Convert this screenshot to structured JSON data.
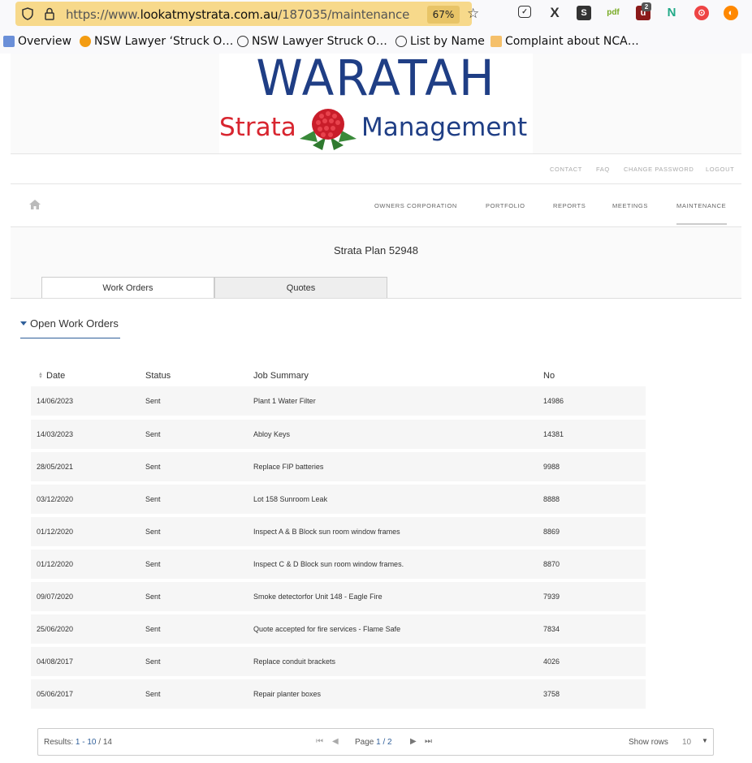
{
  "browser": {
    "url_prefix": "https://www.",
    "url_host": "lookatmystrata.com.au",
    "url_path": "/187035/maintenance",
    "zoom": "67%",
    "extensions": [
      "pocket-icon",
      "x-icon",
      "s-icon",
      "pdf-icon",
      "ublock-icon",
      "n-icon",
      "shield-icon",
      "firefox-icon"
    ],
    "extension_badge": "2",
    "bookmarks": [
      {
        "label": "Overview",
        "icon": "calendar-icon"
      },
      {
        "label": "NSW Lawyer ‘Struck O…",
        "icon": "news-icon"
      },
      {
        "label": "NSW Lawyer Struck O…",
        "icon": "globe-icon"
      },
      {
        "label": "List by Name",
        "icon": "globe-icon"
      },
      {
        "label": "Complaint about NCA…",
        "icon": "document-icon"
      }
    ]
  },
  "logo": {
    "title": "WARATAH",
    "word_left": "Strata",
    "word_right": "Management"
  },
  "utility_nav": [
    "CONTACT",
    "FAQ",
    "CHANGE PASSWORD",
    "LOGOUT"
  ],
  "main_nav": {
    "items": [
      "OWNERS CORPORATION",
      "PORTFOLIO",
      "REPORTS",
      "MEETINGS",
      "MAINTENANCE"
    ],
    "active": "MAINTENANCE"
  },
  "plan_title": "Strata Plan 52948",
  "tabs": [
    "Work Orders",
    "Quotes"
  ],
  "section_title": "Open Work Orders",
  "table": {
    "columns": [
      "Date",
      "Status",
      "Job Summary",
      "No"
    ],
    "rows": [
      {
        "date": "14/06/2023",
        "status": "Sent",
        "summary": "Plant 1 Water Filter",
        "no": "14986"
      },
      {
        "date": "14/03/2023",
        "status": "Sent",
        "summary": "Abloy Keys",
        "no": "14381"
      },
      {
        "date": "28/05/2021",
        "status": "Sent",
        "summary": "Replace FIP batteries",
        "no": "9988"
      },
      {
        "date": "03/12/2020",
        "status": "Sent",
        "summary": "Lot 158 Sunroom Leak",
        "no": "8888"
      },
      {
        "date": "01/12/2020",
        "status": "Sent",
        "summary": "Inspect A & B Block sun room window frames",
        "no": "8869"
      },
      {
        "date": "01/12/2020",
        "status": "Sent",
        "summary": "Inspect C & D Block sun room window frames.",
        "no": "8870"
      },
      {
        "date": "09/07/2020",
        "status": "Sent",
        "summary": "Smoke detectorfor Unit 148 - Eagle Fire",
        "no": "7939"
      },
      {
        "date": "25/06/2020",
        "status": "Sent",
        "summary": "Quote accepted for fire services - Flame Safe",
        "no": "7834"
      },
      {
        "date": "04/08/2017",
        "status": "Sent",
        "summary": "Replace conduit brackets",
        "no": "4026"
      },
      {
        "date": "05/06/2017",
        "status": "Sent",
        "summary": "Repair planter boxes",
        "no": "3758"
      }
    ]
  },
  "pager": {
    "results_label": "Results:",
    "results_value": "1 - 10",
    "results_total": "/ 14",
    "page_label": "Page",
    "page_value": "1 / 2",
    "show_rows_label": "Show rows",
    "show_rows_value": "10"
  }
}
